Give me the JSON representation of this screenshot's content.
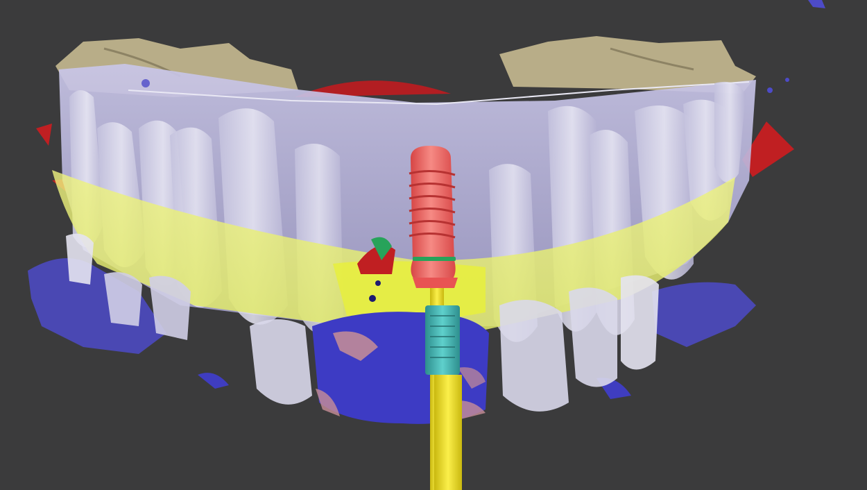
{
  "viewer": {
    "background_color": "#3b3b3c",
    "scene": "3d-dental-implant-planning-view"
  },
  "colors": {
    "bone_tan": "#b8ad88",
    "scan_overlay_lavender": "#b7b4dc",
    "tooth_white": "#d9d8ea",
    "soft_tissue_blue": "#4d4bc8",
    "gingiva_yellow": "#e8ef76",
    "implant_red": "#ef5a5a",
    "guide_sleeve_teal": "#3fb3b0",
    "drill_axis_yellow": "#f2e21a",
    "nerve_red": "#c01f22",
    "marker_green": "#27a35a"
  },
  "objects": {
    "implant_thread_count": 6
  }
}
